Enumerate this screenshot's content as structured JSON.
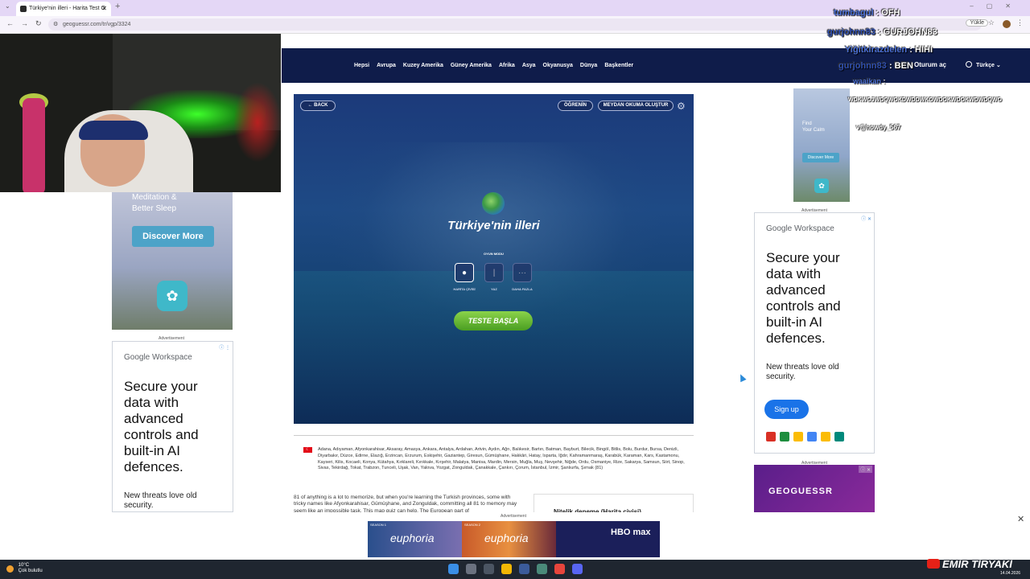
{
  "browser": {
    "tab_title": "Türkiye'nin illeri - Harita Test O",
    "url": "geoguessr.com/tr/vgp/3324",
    "install_label": "Yükle"
  },
  "site_nav": {
    "links": [
      "Hepsi",
      "Avrupa",
      "Kuzey Amerika",
      "Güney Amerika",
      "Afrika",
      "Asya",
      "Okyanusya",
      "Dünya",
      "Başkentler"
    ],
    "login": "Oturum aç",
    "language": "Türkçe"
  },
  "game": {
    "back_label": "BACK",
    "learn_label": "ÖĞRENİN",
    "create_label": "MEYDAN OKUMA OLUŞTUR",
    "title": "Türkiye'nin illeri",
    "mode_title": "OYUN MODU",
    "modes": [
      {
        "label": "HARİTA ÇİVİSİ",
        "icon": "pin-icon",
        "active": true
      },
      {
        "label": "YAZ",
        "icon": "text-cursor-icon",
        "active": false
      },
      {
        "label": "DAHA FAZLA",
        "icon": "more-icon",
        "active": false
      }
    ],
    "start_label": "TESTE BAŞLA"
  },
  "provinces_text": "Adana, Adıyaman, Afyonkarahisar, Aksaray, Amasya, Ankara, Antalya, Ardahan, Artvin, Aydın, Ağrı, Balıkesir, Bartın, Batman, Bayburt, Bilecik, Bingöl, Bitlis, Bolu, Burdur, Bursa, Denizli, Diyarbakır, Düzce, Edirne, Elazığ, Erzincan, Erzurum, Eskişehir, Gaziantep, Giresun, Gümüşhane, Hakkâri, Hatay, Isparta, Iğdır, Kahramanmaraş, Karabük, Karaman, Kars, Kastamonu, Kayseri, Kilis, Kocaeli, Konya, Kütahya, Kırklareli, Kırıkkale, Kırşehir, Malatya, Manisa, Mardin, Mersin, Muğla, Muş, Nevşehir, Niğde, Ordu, Osmaniye, Rize, Sakarya, Samsun, Siirt, Sinop, Sivas, Tekirdağ, Tokat, Trabzon, Tunceli, Uşak, Van, Yalova, Yozgat, Zonguldak, Çanakkale, Çankırı, Çorum, İstanbul, İzmir, Şanlıurfa, Şırnak (81)",
  "description": "81 of anything is a lot to memorize, but when you're learning the Turkish provinces, some with tricky names like Afyonkarahisar, Gümüşhane, and Zonguldak, committing all 81 to memory may seem like an impossible task. This map quiz can help. The European part of",
  "sidebox_title": "Nitelik deneme (Harita çivisi)",
  "ads": {
    "label": "Advertisement",
    "calm_lines": [
      "Meditation &",
      "Better Sleep"
    ],
    "calm_button": "Discover More",
    "calm_small": [
      "Find",
      "Your Calm"
    ],
    "gw_brand": "Google Workspace",
    "gw_headline": "Secure your data with advanced controls and built-in AI defences.",
    "gw_sub": "New threats love old security.",
    "gw_signup": "Sign up",
    "geoguessr_logo": "GEOGUESSR",
    "hbo_left": "euphoria",
    "hbo_mid": "euphoria",
    "hbo_logo": "HBO max",
    "hbo_season1": "SEASON 1",
    "hbo_season2": "SEASON 2"
  },
  "taskbar": {
    "temp": "10°C",
    "weather": "Çok bulutlu",
    "date": "14.04.2026"
  },
  "chat": [
    {
      "user": "tumbagul",
      "text": "OFH"
    },
    {
      "user": "gurjohnn83",
      "text": "GURJOHN83"
    },
    {
      "user": "Yiğitkirazdelen",
      "text": "HIHI"
    },
    {
      "user": "gurjohnn83",
      "text": "BEN"
    },
    {
      "user": "waaikan",
      "text": "WDKWOJWDQWOKDWDDWKOWDOKWDOKWDWDQWO"
    },
    {
      "user": "v@howdy_567",
      "text": ""
    }
  ],
  "channel": "EMİR TİRYAKİ",
  "colors": {
    "nav": "#0f1c4a",
    "start_button": "#6bbf35",
    "gw_blue": "#1a73e8"
  }
}
